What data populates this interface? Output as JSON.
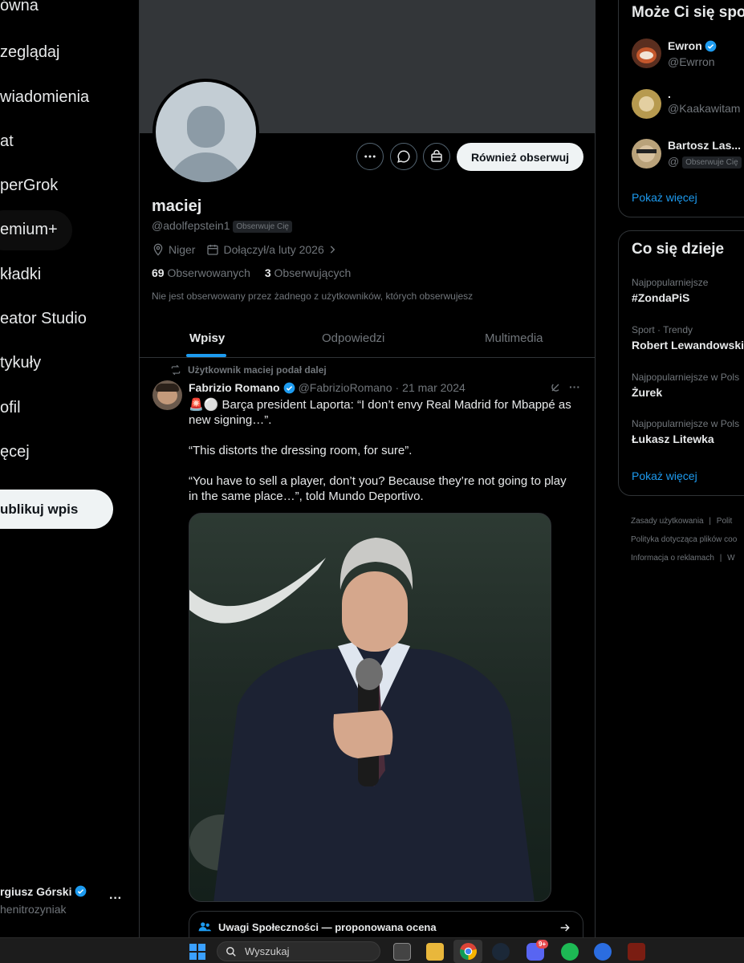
{
  "nav": {
    "items": [
      "ówna",
      "zeglądaj",
      "wiadomienia",
      "at",
      "perGrok",
      "emium+",
      "kładki",
      "eator Studio",
      "tykuły",
      "ofil",
      "ęcej"
    ],
    "post_button": "ublikuj wpis",
    "account_name": "rgiusz Górski",
    "account_handle": "henitrozyniak",
    "more": "···"
  },
  "profile": {
    "name": "maciej",
    "handle": "@adolfepstein1",
    "follows_you": "Obserwuje Cię",
    "location": "Niger",
    "joined": "Dołączył/a luty 2026",
    "following_count": "69",
    "following_label": "Obserwowanych",
    "followers_count": "3",
    "followers_label": "Obserwujących",
    "not_followed_note": "Nie jest obserwowany przez żadnego z użytkowników, których obserwujesz",
    "follow_back_button": "Również obserwuj"
  },
  "tabs": [
    "Wpisy",
    "Odpowiedzi",
    "Multimedia"
  ],
  "post": {
    "repost_note": "Użytkownik maciej podał dalej",
    "author": "Fabrizio Romano",
    "handle": "@FabrizioRomano",
    "date": "21 mar 2024",
    "line1": "🚨⚪️ Barça president Laporta: “I don’t envy Real Madrid for Mbappé as new signing…”.",
    "line2": "“This distorts the dressing room, for sure”.",
    "line3": "“You have to sell a player, don’t you? Because they’re not going to play in the same place…”, told Mundo Deportivo.",
    "community_notes": "Uwagi Społeczności — proponowana ocena",
    "more": "···"
  },
  "who_to_follow": {
    "title": "Może Ci się spo",
    "users": [
      {
        "name": "Ewron",
        "handle": "@Ewrron",
        "badge": ""
      },
      {
        "name": ".",
        "handle": "@Kaakawitam",
        "badge": ""
      },
      {
        "name": "Bartosz Las...",
        "handle": "@",
        "badge": "Obserwuje Cię"
      }
    ],
    "show_more": "Pokaż więcej"
  },
  "trends": {
    "title": "Co się dzieje",
    "items": [
      {
        "meta": "Najpopularniejsze",
        "name": "#ZondaPiS"
      },
      {
        "meta": "Sport · Trendy",
        "name": "Robert Lewandowski"
      },
      {
        "meta": "Najpopularniejsze w Pols",
        "name": "Żurek"
      },
      {
        "meta": "Najpopularniejsze w Pols",
        "name": "Łukasz Litewka"
      }
    ],
    "show_more": "Pokaż więcej"
  },
  "footer": {
    "terms": "Zasady użytkowania",
    "privacy": "Polit",
    "cookies": "Polityka dotycząca plików coo",
    "ads": "Informacja o reklamach",
    "more": "W"
  },
  "taskbar": {
    "search_placeholder": "Wyszukaj",
    "discord_badge": "9+"
  }
}
